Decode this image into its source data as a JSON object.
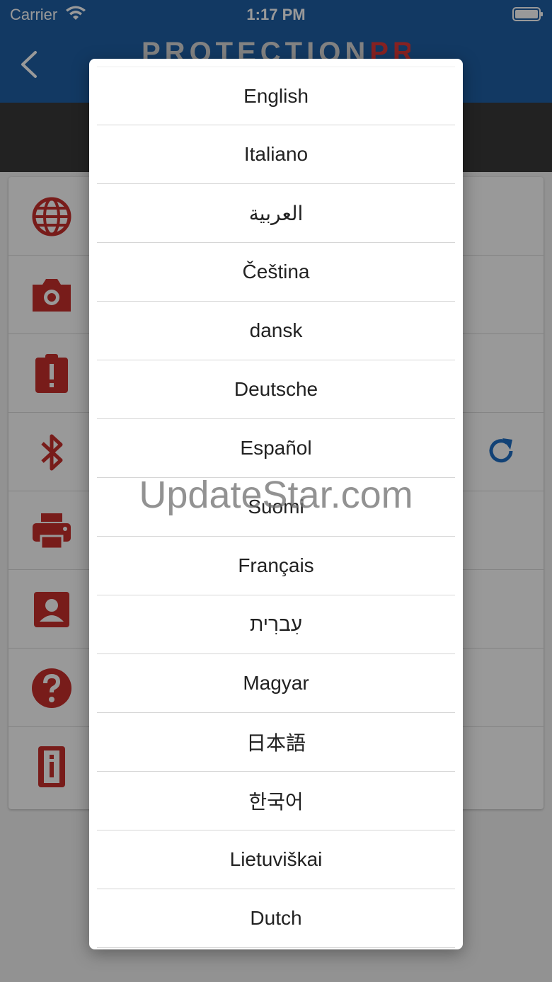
{
  "status_bar": {
    "carrier": "Carrier",
    "time": "1:17 PM"
  },
  "header": {
    "back_icon": "chevron-left-icon",
    "logo_part1": "PROTECTION",
    "logo_part2": "PRO",
    "logo_mark": "®"
  },
  "colors": {
    "header_blue": "#1f5fa5",
    "icon_red": "#c9302c",
    "refresh_blue": "#1f6fc5"
  },
  "settings_icons": [
    "globe-icon",
    "camera-icon",
    "clipboard-alert-icon",
    "bluetooth-icon",
    "printer-icon",
    "contact-card-icon",
    "help-icon",
    "info-icon"
  ],
  "refresh_icon": "refresh-icon",
  "languages": [
    "English",
    "Italiano",
    "العربية",
    "Čeština",
    "dansk",
    "Deutsche",
    "Español",
    "Suomi",
    "Français",
    "עִברִית",
    "Magyar",
    "日本語",
    "한국어",
    "Lietuviškai",
    "Dutch"
  ],
  "watermark": "UpdateStar.com"
}
